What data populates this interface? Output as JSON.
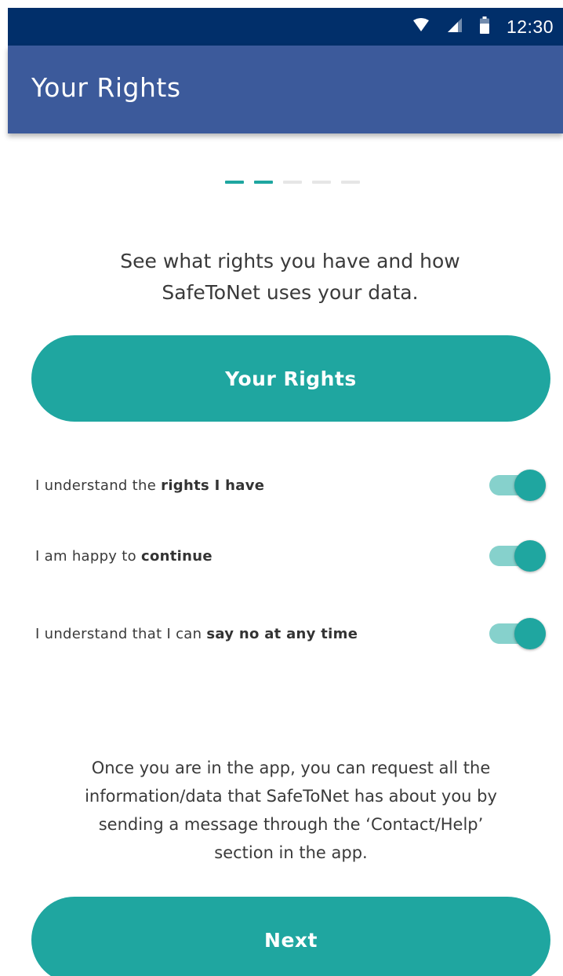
{
  "status_bar": {
    "time": "12:30",
    "icons": [
      "wifi-icon",
      "signal-icon",
      "battery-icon"
    ]
  },
  "app_bar": {
    "title": "Your Rights"
  },
  "stepper": {
    "total_steps": 5,
    "active_steps": 2
  },
  "intro": {
    "line1": "See what rights you have and how",
    "line2": "SafeToNet uses your data."
  },
  "rights_button": {
    "label": "Your Rights"
  },
  "toggles": [
    {
      "prefix": "I understand the ",
      "bold": "rights I have",
      "on": true
    },
    {
      "prefix": "I am happy to ",
      "bold": "continue",
      "on": true
    },
    {
      "prefix": "I understand that I can ",
      "bold": "say no at any time",
      "on": true
    }
  ],
  "info": {
    "line1": "Once you are in the app, you can request all the",
    "line2": "information/data that SafeToNet has about you by",
    "line3": "sending a message through the ‘Contact/Help’",
    "line4": "section in the app."
  },
  "next_button": {
    "label": "Next"
  },
  "colors": {
    "status_bar": "#012f6a",
    "app_bar": "#3c5a9b",
    "accent": "#1fa6a0",
    "toggle_track": "#86d1cc",
    "step_inactive": "#e6e6e6"
  }
}
